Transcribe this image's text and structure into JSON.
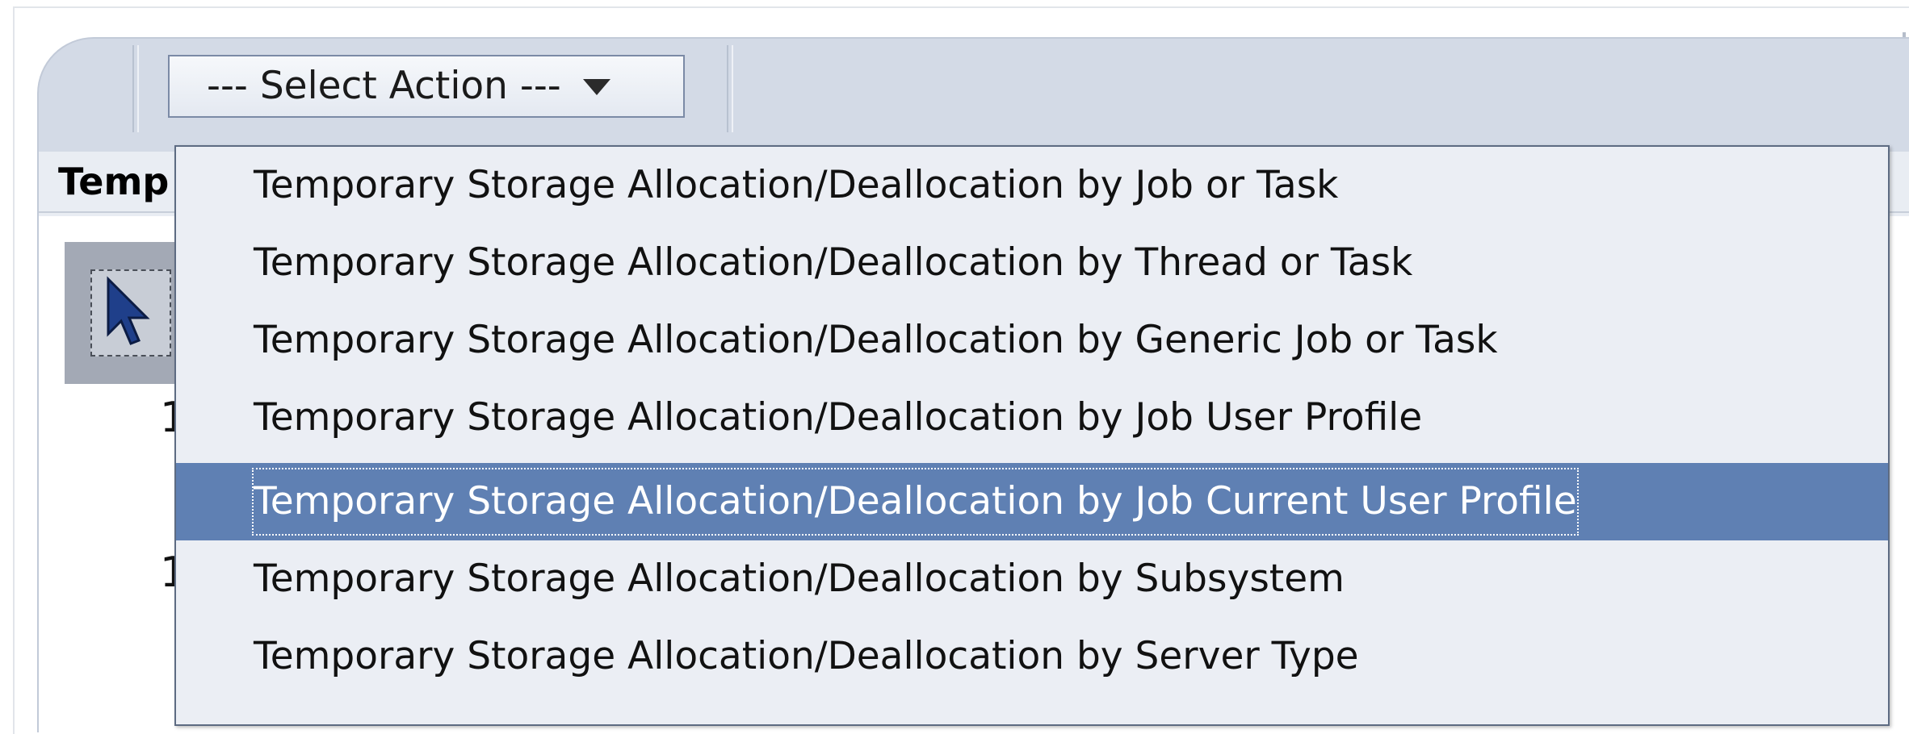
{
  "toolbar": {
    "select_action_label": "--- Select Action ---"
  },
  "table": {
    "column_header": "Temp",
    "row_markers": [
      "1",
      "1"
    ]
  },
  "dropdown": {
    "items": [
      {
        "label": "Temporary Storage Allocation/Deallocation by Job or Task",
        "selected": false
      },
      {
        "label": "Temporary Storage Allocation/Deallocation by Thread or Task",
        "selected": false
      },
      {
        "label": "Temporary Storage Allocation/Deallocation by Generic Job or Task",
        "selected": false
      },
      {
        "label": "Temporary Storage Allocation/Deallocation by Job User Profile",
        "selected": false
      },
      {
        "label": "Temporary Storage Allocation/Deallocation by Job Current User Profile",
        "selected": true
      },
      {
        "label": "Temporary Storage Allocation/Deallocation by Subsystem",
        "selected": false
      },
      {
        "label": "Temporary Storage Allocation/Deallocation by Server Type",
        "selected": false
      }
    ]
  },
  "colors": {
    "panel_bg": "#d3dae6",
    "menu_bg": "#ebeef4",
    "selected_bg": "#5f80b3",
    "selected_text": "#ffffff"
  },
  "icons": {
    "select_tool": "cursor-arrow-icon",
    "dropdown_arrow": "triangle-down-icon"
  }
}
